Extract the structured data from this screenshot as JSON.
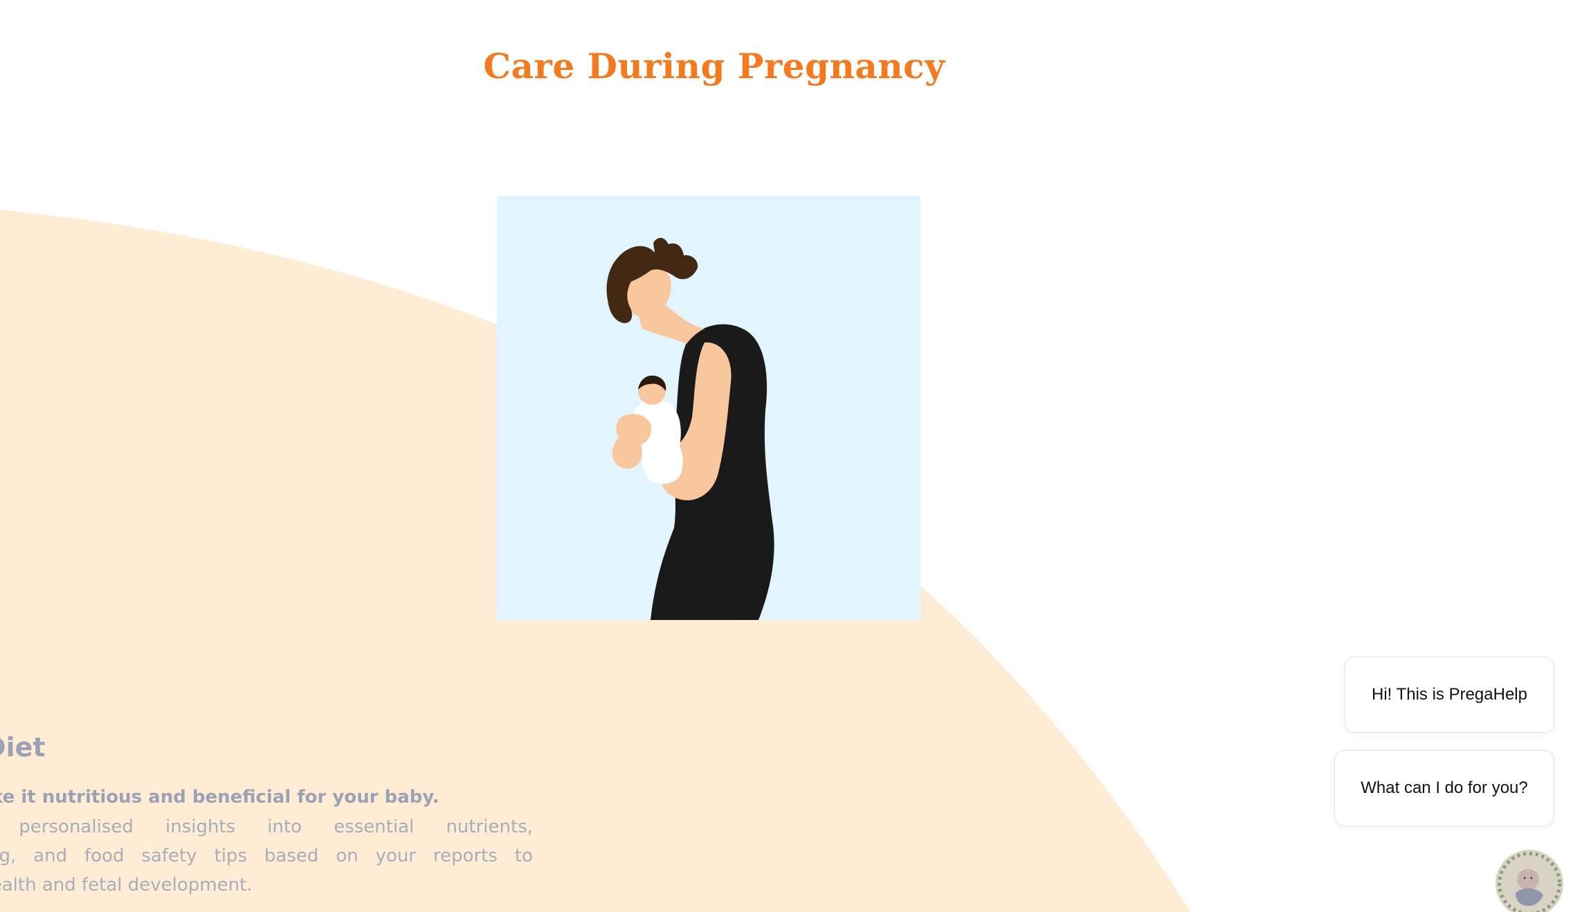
{
  "page": {
    "title": "Care During Pregnancy",
    "colors": {
      "title": "#f47a1f",
      "curve": "#feecd5",
      "illustration_bg": "#e2f4fd",
      "muted_text": "#9aa2b3"
    }
  },
  "hero": {
    "illustration": "mother-holding-baby-illustration"
  },
  "diet": {
    "heading": "ur Diet",
    "subheading": "nts—make it nutritious and beneficial for your baby.",
    "body_lines": [
      "provides personalised insights into essential nutrients,",
      "l planning, and food safety tips based on your reports to",
      "aternal health and fetal development."
    ]
  },
  "chat": {
    "greeting": "Hi! This is PregaHelp",
    "question": "What can I do for you?",
    "avatar_icon": "baby-avatar-icon"
  }
}
